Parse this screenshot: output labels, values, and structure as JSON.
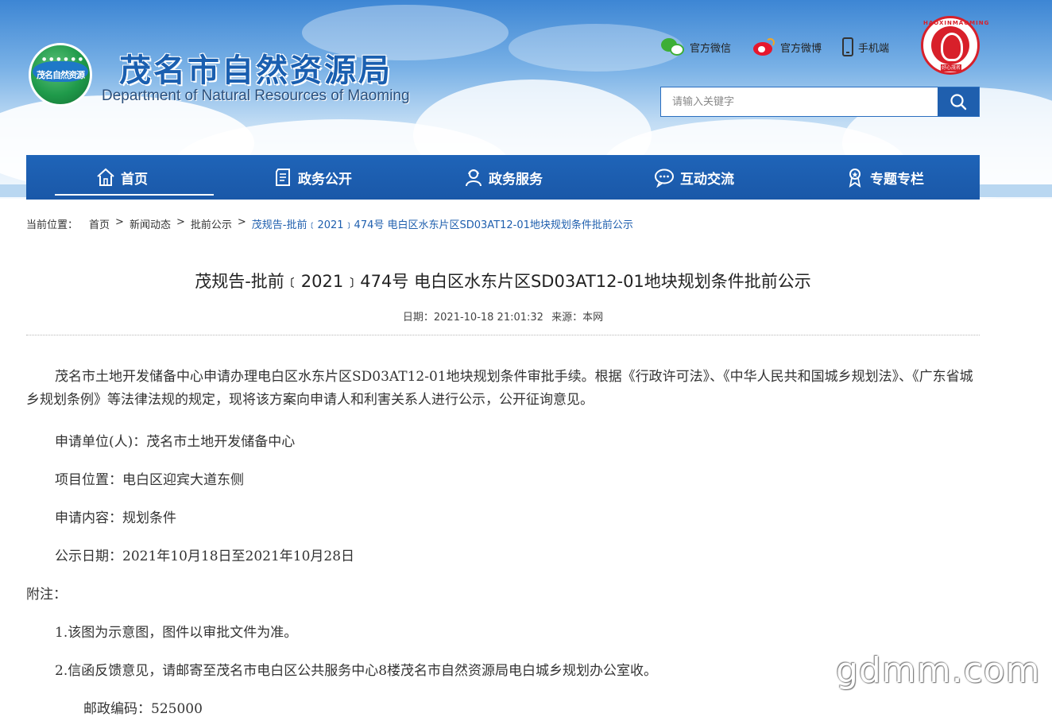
{
  "header": {
    "emblem_text": "茂名自然资源",
    "title": "茂名市自然资源局",
    "subtitle": "Department of Natural Resources of Maoming",
    "links": [
      {
        "label": "官方微信",
        "icon": "wechat-icon"
      },
      {
        "label": "官方微博",
        "icon": "weibo-icon"
      },
      {
        "label": "手机端",
        "icon": "mobile-phone-icon"
      }
    ],
    "seal_ring_text": "HAOXINMAOMING",
    "seal_tag": "好心茂名",
    "search": {
      "placeholder": "请输入关键字",
      "value": ""
    },
    "colors": {
      "brand_blue": "#1f5fae",
      "seal_red": "#d8202a",
      "wechat_green": "#3dae36",
      "weibo_red": "#e6162d"
    }
  },
  "nav": {
    "items": [
      {
        "label": "首页",
        "icon": "home-icon",
        "active": true
      },
      {
        "label": "政务公开",
        "icon": "document-icon",
        "active": false
      },
      {
        "label": "政务服务",
        "icon": "service-person-icon",
        "active": false
      },
      {
        "label": "互动交流",
        "icon": "chat-bubble-icon",
        "active": false
      },
      {
        "label": "专题专栏",
        "icon": "ribbon-icon",
        "active": false
      }
    ]
  },
  "breadcrumb": {
    "lead": "当前位置：",
    "items": [
      "首页",
      "新闻动态",
      "批前公示"
    ],
    "separator": ">",
    "current": "茂规告-批前﹝2021﹞474号 电白区水东片区SD03AT12-01地块规划条件批前公示"
  },
  "article": {
    "title": "茂规告-批前﹝2021﹞474号 电白区水东片区SD03AT12-01地块规划条件批前公示",
    "date": "日期：2021-10-18 21:01:32",
    "source": "来源：本网",
    "paragraphs": [
      "茂名市土地开发储备中心申请办理电白区水东片区SD03AT12-01地块规划条件审批手续。根据《行政许可法》、《中华人民共和国城乡规划法》、《广东省城乡规划条例》等法律法规的规定，现将该方案向申请人和利害关系人进行公示，公开征询意见。",
      "申请单位(人)：茂名市土地开发储备中心",
      "项目位置：电白区迎宾大道东侧",
      "申请内容：规划条件",
      "公示日期：2021年10月18日至2021年10月28日",
      "附注：",
      "1.该图为示意图，图件以审批文件为准。",
      "2.信函反馈意见，请邮寄至茂名市电白区公共服务中心8楼茂名市自然资源局电白城乡规划办公室收。",
      "邮政编码：525000"
    ]
  },
  "watermark": "gdmm.com"
}
